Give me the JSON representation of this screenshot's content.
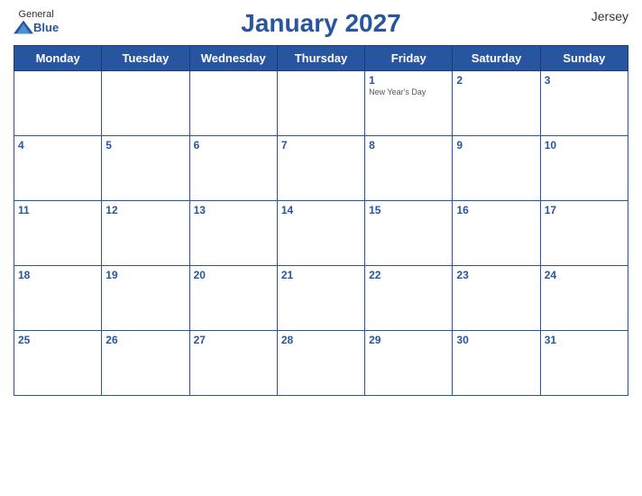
{
  "header": {
    "logo_general": "General",
    "logo_blue": "Blue",
    "month_year": "January 2027",
    "region": "Jersey"
  },
  "weekdays": [
    "Monday",
    "Tuesday",
    "Wednesday",
    "Thursday",
    "Friday",
    "Saturday",
    "Sunday"
  ],
  "weeks": [
    [
      {
        "day": "",
        "holiday": ""
      },
      {
        "day": "",
        "holiday": ""
      },
      {
        "day": "",
        "holiday": ""
      },
      {
        "day": "",
        "holiday": ""
      },
      {
        "day": "1",
        "holiday": "New Year's Day"
      },
      {
        "day": "2",
        "holiday": ""
      },
      {
        "day": "3",
        "holiday": ""
      }
    ],
    [
      {
        "day": "4",
        "holiday": ""
      },
      {
        "day": "5",
        "holiday": ""
      },
      {
        "day": "6",
        "holiday": ""
      },
      {
        "day": "7",
        "holiday": ""
      },
      {
        "day": "8",
        "holiday": ""
      },
      {
        "day": "9",
        "holiday": ""
      },
      {
        "day": "10",
        "holiday": ""
      }
    ],
    [
      {
        "day": "11",
        "holiday": ""
      },
      {
        "day": "12",
        "holiday": ""
      },
      {
        "day": "13",
        "holiday": ""
      },
      {
        "day": "14",
        "holiday": ""
      },
      {
        "day": "15",
        "holiday": ""
      },
      {
        "day": "16",
        "holiday": ""
      },
      {
        "day": "17",
        "holiday": ""
      }
    ],
    [
      {
        "day": "18",
        "holiday": ""
      },
      {
        "day": "19",
        "holiday": ""
      },
      {
        "day": "20",
        "holiday": ""
      },
      {
        "day": "21",
        "holiday": ""
      },
      {
        "day": "22",
        "holiday": ""
      },
      {
        "day": "23",
        "holiday": ""
      },
      {
        "day": "24",
        "holiday": ""
      }
    ],
    [
      {
        "day": "25",
        "holiday": ""
      },
      {
        "day": "26",
        "holiday": ""
      },
      {
        "day": "27",
        "holiday": ""
      },
      {
        "day": "28",
        "holiday": ""
      },
      {
        "day": "29",
        "holiday": ""
      },
      {
        "day": "30",
        "holiday": ""
      },
      {
        "day": "31",
        "holiday": ""
      }
    ]
  ]
}
